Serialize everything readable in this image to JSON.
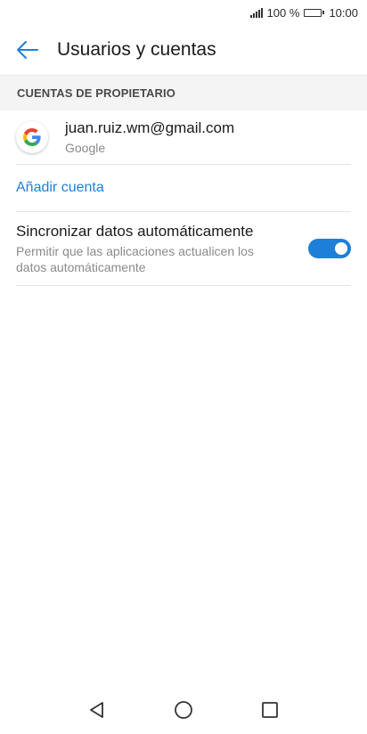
{
  "status_bar": {
    "battery": "100 %",
    "time": "10:00"
  },
  "header": {
    "title": "Usuarios y cuentas"
  },
  "section": {
    "title": "CUENTAS DE PROPIETARIO"
  },
  "account": {
    "email": "juan.ruiz.wm@gmail.com",
    "type": "Google"
  },
  "add_account": {
    "label": "Añadir cuenta"
  },
  "sync": {
    "title": "Sincronizar datos automáticamente",
    "description": "Permitir que las aplicaciones actualicen los datos automáticamente",
    "enabled": true
  },
  "colors": {
    "accent": "#1e7fd8"
  }
}
